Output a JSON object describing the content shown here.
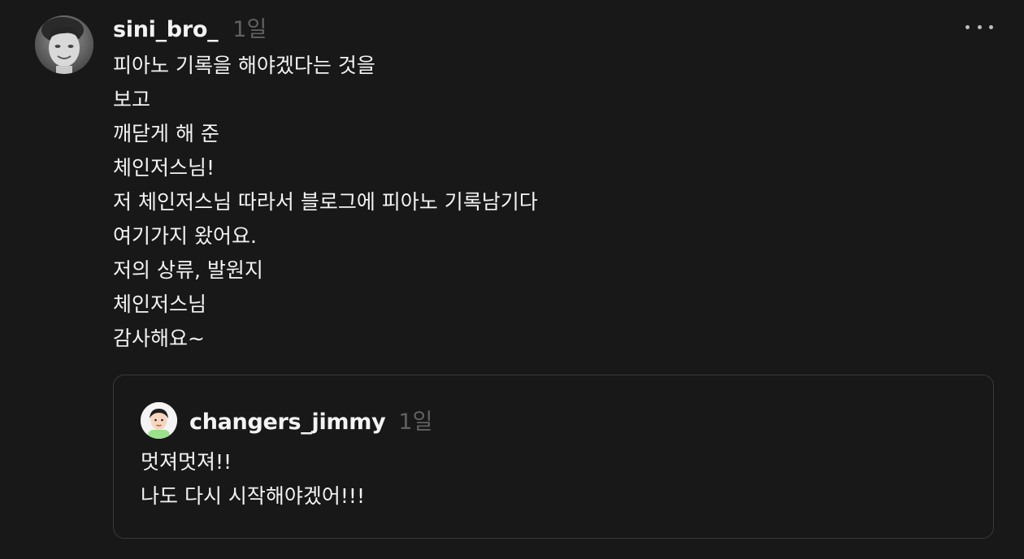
{
  "post": {
    "author": "sini_bro_",
    "time": "1일",
    "lines": [
      "피아노 기록을 해야겠다는 것을",
      "보고",
      "깨닫게 해 준",
      "체인저스님!",
      "저 체인저스님 따라서 블로그에 피아노 기록남기다",
      "여기가지 왔어요.",
      "저의 상류, 발원지",
      "체인저스님",
      "감사해요~"
    ],
    "more_icon": "more-horizontal-icon"
  },
  "quoted": {
    "author": "changers_jimmy",
    "time": "1일",
    "lines": [
      "멋져멋져!!",
      "나도 다시 시작해야겠어!!!"
    ]
  }
}
